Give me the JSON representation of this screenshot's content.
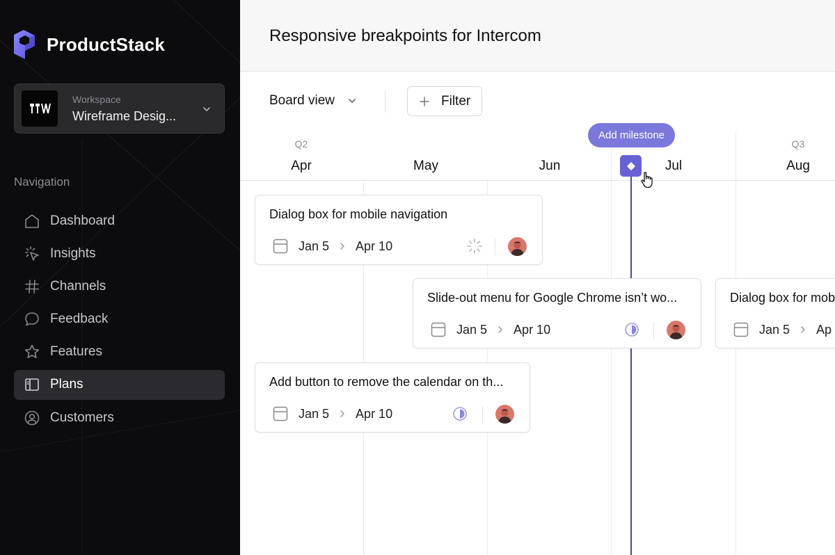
{
  "app": {
    "name": "ProductStack"
  },
  "workspace": {
    "caption": "Workspace",
    "name": "Wireframe Desig..."
  },
  "navigation": {
    "caption": "Navigation",
    "items": [
      {
        "label": "Dashboard",
        "icon": "home-icon",
        "active": false
      },
      {
        "label": "Insights",
        "icon": "sparkle-cursor-icon",
        "active": false
      },
      {
        "label": "Channels",
        "icon": "hash-icon",
        "active": false
      },
      {
        "label": "Feedback",
        "icon": "chat-bubble-icon",
        "active": false
      },
      {
        "label": "Features",
        "icon": "star-icon",
        "active": false
      },
      {
        "label": "Plans",
        "icon": "book-icon",
        "active": true
      },
      {
        "label": "Customers",
        "icon": "user-circle-icon",
        "active": false
      }
    ]
  },
  "header": {
    "title": "Responsive breakpoints for Intercom"
  },
  "toolbar": {
    "view_label": "Board view",
    "filter_label": "Filter"
  },
  "timeline": {
    "quarters": [
      "Q2",
      "Q3"
    ],
    "months": [
      "Apr",
      "May",
      "Jun",
      "Jul",
      "Aug"
    ],
    "milestone_label": "Add milestone",
    "cards": [
      {
        "title": "Dialog box for mobile navigation",
        "start": "Jan 5",
        "end": "Apr 10",
        "status": "loading"
      },
      {
        "title": "Slide-out menu for Google Chrome isn’t wo...",
        "start": "Jan 5",
        "end": "Apr 10",
        "status": "half"
      },
      {
        "title": "Dialog box for mob",
        "start": "Jan 5",
        "end": "Ap",
        "status": "none"
      },
      {
        "title": "Add button to remove the calendar on th...",
        "start": "Jan 5",
        "end": "Apr 10",
        "status": "half"
      }
    ]
  },
  "colors": {
    "accent": "#6662d6",
    "sidebar_bg": "#0c0c0e",
    "milestone_pill": "#7b78dc"
  }
}
